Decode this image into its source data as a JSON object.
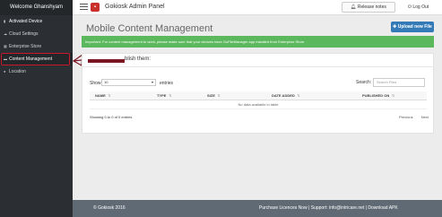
{
  "sidebar": {
    "welcome": "Welcome Ghanshyam",
    "items": [
      {
        "label": "Activated Device",
        "icon": "tablet-icon"
      },
      {
        "label": "Cloud Settings",
        "icon": "cloud-icon"
      },
      {
        "label": "Enterprise Store",
        "icon": "store-icon"
      },
      {
        "label": "Content Management",
        "icon": "folder-icon"
      },
      {
        "label": "Location",
        "icon": "location-pin-icon"
      }
    ]
  },
  "topbar": {
    "app_title": "Gokiosk Admin Panel",
    "release_notes": "Release notes",
    "logout": "Log Out"
  },
  "main": {
    "title": "Mobile Content Management",
    "upload_button": "Upload new File",
    "alert": "Important: For content management to work, please make sure that your devices have GoFileManager app installed from Enterprise Store.",
    "panel_heading": "blish them:",
    "show_label": "Show",
    "show_value": "10",
    "entries_label": "entries",
    "search_label": "Search:",
    "search_placeholder": "Search Files",
    "columns": [
      "NAME",
      "TYPE",
      "SIZE",
      "DATE ADDED",
      "PUBLISHED ON"
    ],
    "empty_message": "No data available in table",
    "info": "Showing 0 to 0 of 0 entries",
    "prev": "Previous",
    "next": "Next"
  },
  "footer": {
    "copyright": "© Gokiosk 2016",
    "links": "Purchase Licences Now | Support: info@intricare.net | Download APK"
  },
  "colors": {
    "sidebar": "#2b2f33",
    "alert_green": "#5cb85c",
    "primary_blue": "#337ab7",
    "footer": "#606a74",
    "highlight_red": "#c9182b"
  }
}
